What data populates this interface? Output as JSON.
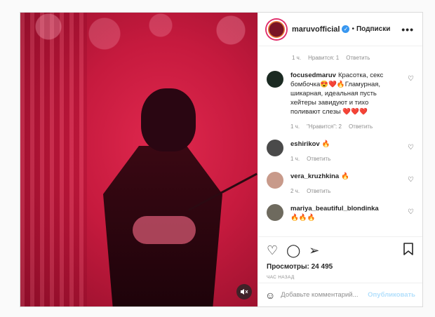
{
  "header": {
    "username": "maruvofficial",
    "separator": "•",
    "follow_label": "Подписки",
    "more_icon": "•••"
  },
  "caption_meta": {
    "time": "1 ч.",
    "likes": "Нравится: 1",
    "reply": "Ответить"
  },
  "comments": [
    {
      "user": "focusedmaruv",
      "text": "Красотка, секс бомбочка😍❤️🔥Гламурная, шикарная, идеальная пусть хейтеры завидуют и тихо поливают слезы ❤️❤️❤️",
      "time": "1 ч.",
      "likes": "\"Нравится\": 2",
      "reply": "Ответить",
      "avatar_color": "#1b2a22"
    },
    {
      "user": "eshirikov",
      "text": "🔥",
      "time": "1 ч.",
      "reply": "Ответить",
      "avatar_color": "#4a4a4a"
    },
    {
      "user": "vera_kruzhkina",
      "text": "🔥",
      "time": "2 ч.",
      "reply": "Ответить",
      "avatar_color": "#c89a8a"
    },
    {
      "user": "mariya_beautiful_blondinka",
      "text": "🔥🔥🔥",
      "avatar_color": "#6e6a5e"
    }
  ],
  "actions": {
    "like_icon": "♡",
    "comment_icon": "◯",
    "share_icon": "➢",
    "bookmark_icon": "🔖",
    "views": "Просмотры: 24 495",
    "time": "ЧАС НАЗАД"
  },
  "add_comment": {
    "emoji_icon": "☺",
    "placeholder": "Добавьте комментарий...",
    "publish_label": "Опубликовать"
  },
  "colors": {
    "accent_blue": "#3897f0",
    "publish_disabled": "#b2dffc",
    "media_red": "#c61a3e"
  }
}
